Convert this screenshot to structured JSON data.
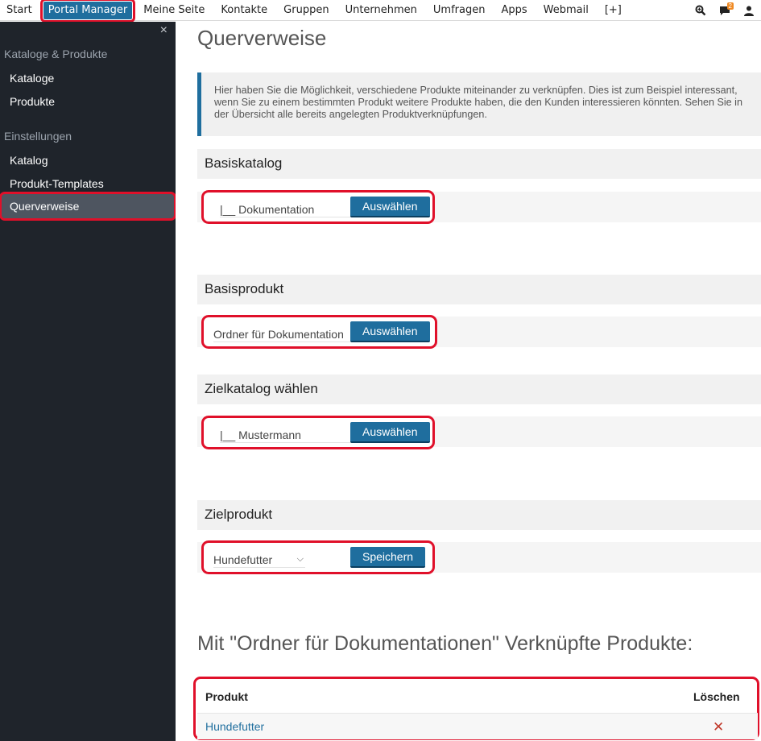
{
  "topnav": {
    "items": [
      "Start",
      "Portal Manager",
      "Meine Seite",
      "Kontakte",
      "Gruppen",
      "Unternehmen",
      "Umfragen",
      "Apps",
      "Webmail",
      "[+]"
    ],
    "badge": "2",
    "icons": [
      "search-icon",
      "chat-icon",
      "user-icon"
    ]
  },
  "sidebar": {
    "close": "×",
    "section1": "Kataloge & Produkte",
    "items1": [
      "Kataloge",
      "Produkte"
    ],
    "section2": "Einstellungen",
    "items2": [
      "Katalog",
      "Produkt-Templates"
    ],
    "active": "Querverweise"
  },
  "page": {
    "title": "Querverweise",
    "info": "Hier haben Sie die Möglichkeit, verschiedene Produkte miteinander zu verknüpfen. Dies ist zum Beispiel interessant, wenn Sie zu einem bestimmten Produkt weitere Produkte haben, die den Kunden interessieren könnten. Sehen Sie in der Übersicht alle bereits angelegten Produktverknüpfungen."
  },
  "basiskatalog": {
    "heading": "Basiskatalog",
    "value": "|__ Dokumentation",
    "button": "Auswählen"
  },
  "basisprodukt": {
    "heading": "Basisprodukt",
    "value": "Ordner für Dokumentation",
    "button": "Auswählen"
  },
  "zielkatalog": {
    "heading": "Zielkatalog wählen",
    "value": "|__ Mustermann",
    "button": "Auswählen"
  },
  "zielprodukt": {
    "heading": "Zielprodukt",
    "value": "Hundefutter",
    "button": "Speichern"
  },
  "linked": {
    "title": "Mit \"Ordner für Dokumentationen\" Verknüpfte Produkte:",
    "col_product": "Produkt",
    "col_delete": "Löschen",
    "rows": [
      {
        "product": "Hundefutter",
        "delete": "✕"
      }
    ]
  },
  "colors": {
    "accent": "#1f6e9e",
    "highlight": "#e0102a",
    "sidebar": "#1f242b"
  }
}
